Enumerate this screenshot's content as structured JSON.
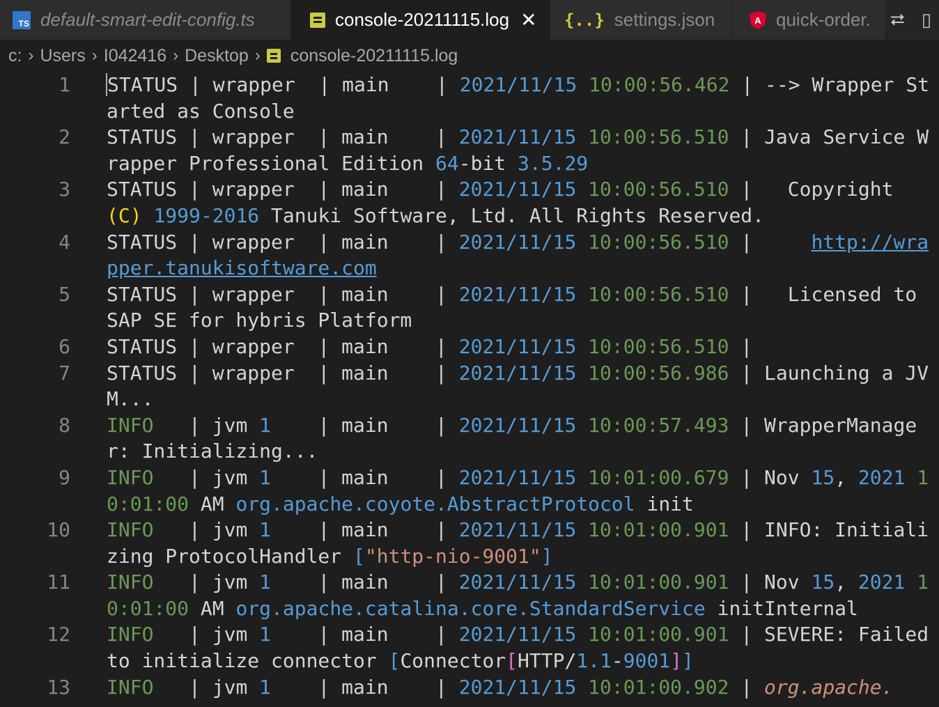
{
  "tabs": [
    {
      "label": "default-smart-edit-config.ts",
      "icon": "typescript-icon",
      "icon_text": "TS",
      "italic": true,
      "active": false
    },
    {
      "label": "console-20211115.log",
      "icon": "log-file-icon",
      "italic": false,
      "active": true,
      "close": "✕"
    },
    {
      "label": "settings.json",
      "icon": "json-braces-icon",
      "icon_text": "{..}",
      "italic": false,
      "active": false
    },
    {
      "label": "quick-order.",
      "icon": "angular-icon",
      "icon_text": "A",
      "italic": false,
      "active": false
    }
  ],
  "tab_actions": {
    "compare_icon": "⮂",
    "split_icon": "▯"
  },
  "breadcrumb": [
    "c:",
    "Users",
    "I042416",
    "Desktop",
    "console-20211115.log"
  ],
  "colors": {
    "background": "#1e1e1e",
    "tab_bar": "#252526",
    "date_blue": "#569cd6",
    "time_green": "#6a9955",
    "string_orange": "#ce9178",
    "paren_gold": "#ffd700"
  },
  "lines": [
    {
      "n": "1",
      "segments": [
        [
          "",
          "STATUS | wrapper  | main    | "
        ],
        [
          "date",
          "2021/11/15"
        ],
        [
          "",
          " "
        ],
        [
          "time",
          "10:00:56.462"
        ],
        [
          "",
          " | --> Wrapper Started as Console"
        ]
      ]
    },
    {
      "n": "2",
      "segments": [
        [
          "",
          "STATUS | wrapper  | main    | "
        ],
        [
          "date",
          "2021/11/15"
        ],
        [
          "",
          " "
        ],
        [
          "time",
          "10:00:56.510"
        ],
        [
          "",
          " | Java Service Wrapper Professional Edition "
        ],
        [
          "num",
          "64"
        ],
        [
          "",
          "-bit "
        ],
        [
          "num",
          "3.5.29"
        ]
      ]
    },
    {
      "n": "3",
      "segments": [
        [
          "",
          "STATUS | wrapper  | main    | "
        ],
        [
          "date",
          "2021/11/15"
        ],
        [
          "",
          " "
        ],
        [
          "time",
          "10:00:56.510"
        ],
        [
          "",
          " |   Copyright "
        ],
        [
          "paren",
          "(C)"
        ],
        [
          "",
          " "
        ],
        [
          "num",
          "1999-2016"
        ],
        [
          "",
          " Tanuki Software, Ltd. All Rights Reserved."
        ]
      ]
    },
    {
      "n": "4",
      "segments": [
        [
          "",
          "STATUS | wrapper  | main    | "
        ],
        [
          "date",
          "2021/11/15"
        ],
        [
          "",
          " "
        ],
        [
          "time",
          "10:00:56.510"
        ],
        [
          "",
          " |     "
        ],
        [
          "link",
          "http://wrapper.tanukisoftware.com"
        ]
      ]
    },
    {
      "n": "5",
      "segments": [
        [
          "",
          "STATUS | wrapper  | main    | "
        ],
        [
          "date",
          "2021/11/15"
        ],
        [
          "",
          " "
        ],
        [
          "time",
          "10:00:56.510"
        ],
        [
          "",
          " |   Licensed to SAP SE for hybris Platform"
        ]
      ]
    },
    {
      "n": "6",
      "segments": [
        [
          "",
          "STATUS | wrapper  | main    | "
        ],
        [
          "date",
          "2021/11/15"
        ],
        [
          "",
          " "
        ],
        [
          "time",
          "10:00:56.510"
        ],
        [
          "",
          " |"
        ]
      ]
    },
    {
      "n": "7",
      "segments": [
        [
          "",
          "STATUS | wrapper  | main    | "
        ],
        [
          "date",
          "2021/11/15"
        ],
        [
          "",
          " "
        ],
        [
          "time",
          "10:00:56.986"
        ],
        [
          "",
          " | Launching a JVM..."
        ]
      ]
    },
    {
      "n": "8",
      "segments": [
        [
          "info",
          "INFO"
        ],
        [
          "",
          "   | jvm "
        ],
        [
          "num",
          "1"
        ],
        [
          "",
          "    | main    | "
        ],
        [
          "date",
          "2021/11/15"
        ],
        [
          "",
          " "
        ],
        [
          "time",
          "10:00:57.493"
        ],
        [
          "",
          " | WrapperManager: Initializing..."
        ]
      ]
    },
    {
      "n": "9",
      "segments": [
        [
          "info",
          "INFO"
        ],
        [
          "",
          "   | jvm "
        ],
        [
          "num",
          "1"
        ],
        [
          "",
          "    | main    | "
        ],
        [
          "date",
          "2021/11/15"
        ],
        [
          "",
          " "
        ],
        [
          "time",
          "10:01:00.679"
        ],
        [
          "",
          " | Nov "
        ],
        [
          "num",
          "15"
        ],
        [
          "",
          ", "
        ],
        [
          "num",
          "2021"
        ],
        [
          "",
          " "
        ],
        [
          "time",
          "10:01:00"
        ],
        [
          "",
          " AM "
        ],
        [
          "cls",
          "org.apache.coyote.AbstractProtocol"
        ],
        [
          "",
          " init"
        ]
      ]
    },
    {
      "n": "10",
      "segments": [
        [
          "info",
          "INFO"
        ],
        [
          "",
          "   | jvm "
        ],
        [
          "num",
          "1"
        ],
        [
          "",
          "    | main    | "
        ],
        [
          "date",
          "2021/11/15"
        ],
        [
          "",
          " "
        ],
        [
          "time",
          "10:01:00.901"
        ],
        [
          "",
          " | INFO: Initializing ProtocolHandler "
        ],
        [
          "brk",
          "["
        ],
        [
          "str",
          "\"http-nio-9001\""
        ],
        [
          "brk",
          "]"
        ]
      ]
    },
    {
      "n": "11",
      "segments": [
        [
          "info",
          "INFO"
        ],
        [
          "",
          "   | jvm "
        ],
        [
          "num",
          "1"
        ],
        [
          "",
          "    | main    | "
        ],
        [
          "date",
          "2021/11/15"
        ],
        [
          "",
          " "
        ],
        [
          "time",
          "10:01:00.901"
        ],
        [
          "",
          " | Nov "
        ],
        [
          "num",
          "15"
        ],
        [
          "",
          ", "
        ],
        [
          "num",
          "2021"
        ],
        [
          "",
          " "
        ],
        [
          "time",
          "10:01:00"
        ],
        [
          "",
          " AM "
        ],
        [
          "cls",
          "org.apache.catalina.core.StandardService"
        ],
        [
          "",
          " initInternal"
        ]
      ]
    },
    {
      "n": "12",
      "segments": [
        [
          "info",
          "INFO"
        ],
        [
          "",
          "   | jvm "
        ],
        [
          "num",
          "1"
        ],
        [
          "",
          "    | main    | "
        ],
        [
          "date",
          "2021/11/15"
        ],
        [
          "",
          " "
        ],
        [
          "time",
          "10:01:00.901"
        ],
        [
          "",
          " | SEVERE: Failed to initialize connector "
        ],
        [
          "brk",
          "["
        ],
        [
          "",
          "Connector"
        ],
        [
          "brk2",
          "["
        ],
        [
          "",
          "HTTP/"
        ],
        [
          "num",
          "1.1"
        ],
        [
          "",
          "-"
        ],
        [
          "num",
          "9001"
        ],
        [
          "brk2",
          "]"
        ],
        [
          "brk",
          "]"
        ]
      ]
    },
    {
      "n": "13",
      "segments": [
        [
          "info",
          "INFO"
        ],
        [
          "",
          "   | jvm "
        ],
        [
          "num",
          "1"
        ],
        [
          "",
          "    | main    | "
        ],
        [
          "date",
          "2021/11/15"
        ],
        [
          "",
          " "
        ],
        [
          "time",
          "10:01:00.902"
        ],
        [
          "",
          " | "
        ],
        [
          "warn",
          "org.apache."
        ]
      ]
    }
  ]
}
